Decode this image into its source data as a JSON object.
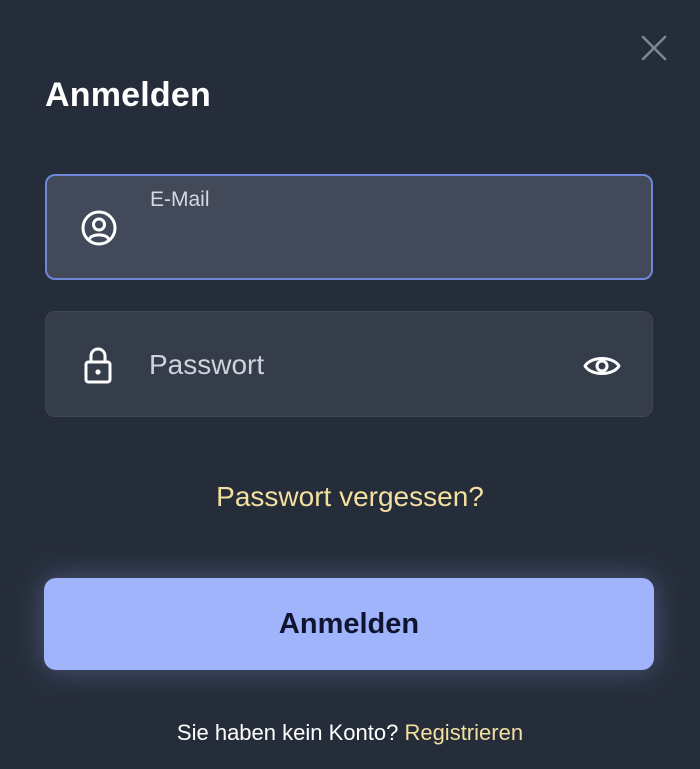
{
  "dialog": {
    "title": "Anmelden",
    "close_icon": "close-icon"
  },
  "email": {
    "label": "E-Mail",
    "value": "",
    "icon": "user-circle-icon"
  },
  "password": {
    "placeholder": "Passwort",
    "value": "",
    "icon": "lock-icon",
    "toggle_icon": "eye-icon"
  },
  "forgot_password": "Passwort vergessen?",
  "submit_label": "Anmelden",
  "footer": {
    "text": "Sie haben kein Konto?",
    "register_label": "Registrieren"
  },
  "colors": {
    "background": "#262d3a",
    "accent": "#a0b4fc",
    "link": "#f3df9f",
    "focus_border": "#6f86d9"
  }
}
